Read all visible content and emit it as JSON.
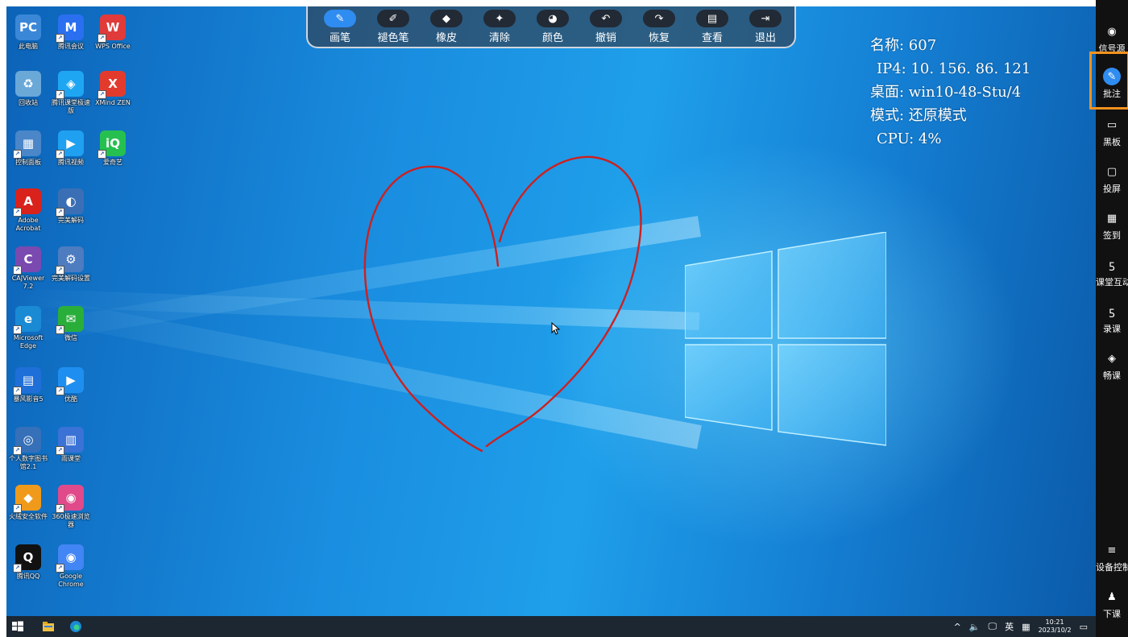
{
  "toolbar": {
    "items": [
      {
        "label": "画笔",
        "icon": "pen-icon",
        "active": true
      },
      {
        "label": "褪色笔",
        "icon": "fade-pen-icon"
      },
      {
        "label": "橡皮",
        "icon": "eraser-icon"
      },
      {
        "label": "清除",
        "icon": "broom-icon"
      },
      {
        "label": "颜色",
        "icon": "palette-icon"
      },
      {
        "label": "撤销",
        "icon": "undo-icon"
      },
      {
        "label": "恢复",
        "icon": "redo-icon"
      },
      {
        "label": "查看",
        "icon": "view-icon"
      },
      {
        "label": "退出",
        "icon": "exit-icon"
      }
    ]
  },
  "info": {
    "name": "名称: 607",
    "ip": "IP4: 10. 156. 86. 121",
    "desktop": "桌面: win10-48-Stu/4",
    "mode": "模式: 还原模式",
    "cpu": "CPU: 4%"
  },
  "sidebar": {
    "items": [
      {
        "label": "信号源",
        "icon": "signal-icon"
      },
      {
        "label": "批注",
        "icon": "annotate-icon",
        "active": true
      },
      {
        "label": "黑板",
        "icon": "blackboard-icon"
      },
      {
        "label": "投屏",
        "icon": "cast-icon"
      },
      {
        "label": "签到",
        "icon": "checkin-icon"
      },
      {
        "label": "课堂互动",
        "icon": "interact-icon"
      },
      {
        "label": "录课",
        "icon": "record-icon"
      },
      {
        "label": "畅课",
        "icon": "layers-icon"
      }
    ],
    "bottom": [
      {
        "label": "设备控制",
        "icon": "menu-icon"
      },
      {
        "label": "下课",
        "icon": "bell-icon"
      }
    ]
  },
  "desktop_icons": [
    {
      "label": "此电脑",
      "color": "#3a87d8",
      "glyph": "PC"
    },
    {
      "label": "腾讯会议",
      "color": "#2a6ff0",
      "glyph": "M"
    },
    {
      "label": "WPS Office",
      "color": "#e03a3a",
      "glyph": "W"
    },
    {
      "label": "回收站",
      "color": "#6aa8d8",
      "glyph": "♻"
    },
    {
      "label": "腾讯课堂极速版",
      "color": "#1fa6f2",
      "glyph": "◈"
    },
    {
      "label": "XMind ZEN",
      "color": "#e23b2e",
      "glyph": "X"
    },
    {
      "label": "控制面板",
      "color": "#4a86c8",
      "glyph": "▦"
    },
    {
      "label": "腾讯视频",
      "color": "#1fa0f0",
      "glyph": "▶"
    },
    {
      "label": "爱奇艺",
      "color": "#26c051",
      "glyph": "iQ"
    },
    {
      "label": "Adobe Acrobat",
      "color": "#d9221c",
      "glyph": "A"
    },
    {
      "label": "完美解码",
      "color": "#3b6fb5",
      "glyph": "◐"
    },
    {
      "label": "CAJViewer 7.2",
      "color": "#7a4ab0",
      "glyph": "C"
    },
    {
      "label": "完美解码设置",
      "color": "#4d7cc0",
      "glyph": "⚙"
    },
    {
      "label": "Microsoft Edge",
      "color": "#1a8ad4",
      "glyph": "e"
    },
    {
      "label": "微信",
      "color": "#2aae3a",
      "glyph": "✉"
    },
    {
      "label": "暴风影音5",
      "color": "#1f6fd8",
      "glyph": "▤"
    },
    {
      "label": "优酷",
      "color": "#1e8ff0",
      "glyph": "▶"
    },
    {
      "label": "个人数字图书馆2.1",
      "color": "#3570b8",
      "glyph": "◎"
    },
    {
      "label": "雨课堂",
      "color": "#3a72d6",
      "glyph": "▥"
    },
    {
      "label": "火绒安全软件",
      "color": "#f09a1c",
      "glyph": "◆"
    },
    {
      "label": "360极速浏览器",
      "color": "#e04a8a",
      "glyph": "◉"
    },
    {
      "label": "腾讯QQ",
      "color": "#111111",
      "glyph": "Q"
    },
    {
      "label": "Google Chrome",
      "color": "#4285f4",
      "glyph": "◉"
    }
  ],
  "taskbar": {
    "tray_ime": "英",
    "time": "10:21",
    "date": "2023/10/2"
  },
  "colors": {
    "accent": "#2f8cf0",
    "highlight": "#f5931e",
    "ink": "#cc2020"
  }
}
